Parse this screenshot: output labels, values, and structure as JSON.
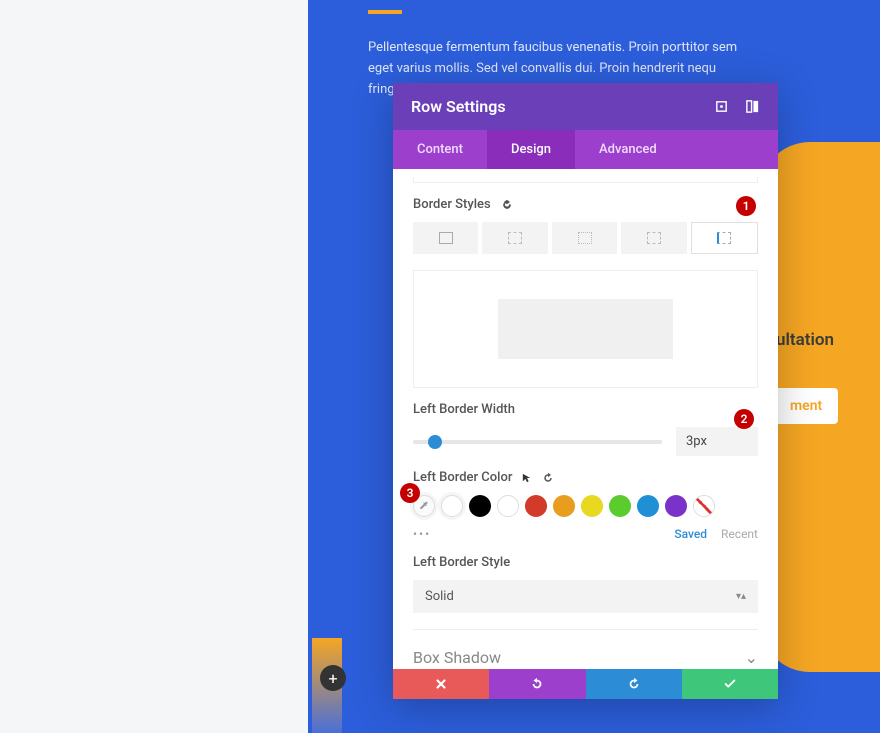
{
  "body_text": "Pellentesque fermentum faucibus venenatis. Proin porttitor sem eget varius mollis. Sed vel convallis dui. Proin hendrerit nequ",
  "body_text2": "fringi",
  "side": {
    "title": "ultation",
    "button": "ment"
  },
  "add_label": "+",
  "modal": {
    "title": "Row Settings",
    "tabs": [
      "Content",
      "Design",
      "Advanced"
    ],
    "active_tab": 1,
    "border_styles_label": "Border Styles",
    "left_border_width_label": "Left Border Width",
    "left_border_width_value": "3px",
    "left_border_color_label": "Left Border Color",
    "swatches": [
      "#000000",
      "#ffffff",
      "#d23a2a",
      "#e89d1f",
      "#e8d81f",
      "#5bcc2e",
      "#1f90d6",
      "#7b32c9"
    ],
    "color_tabs": {
      "saved": "Saved",
      "recent": "Recent"
    },
    "left_border_style_label": "Left Border Style",
    "left_border_style_value": "Solid",
    "box_shadow_label": "Box Shadow"
  },
  "badges": {
    "b1": "1",
    "b2": "2",
    "b3": "3"
  }
}
